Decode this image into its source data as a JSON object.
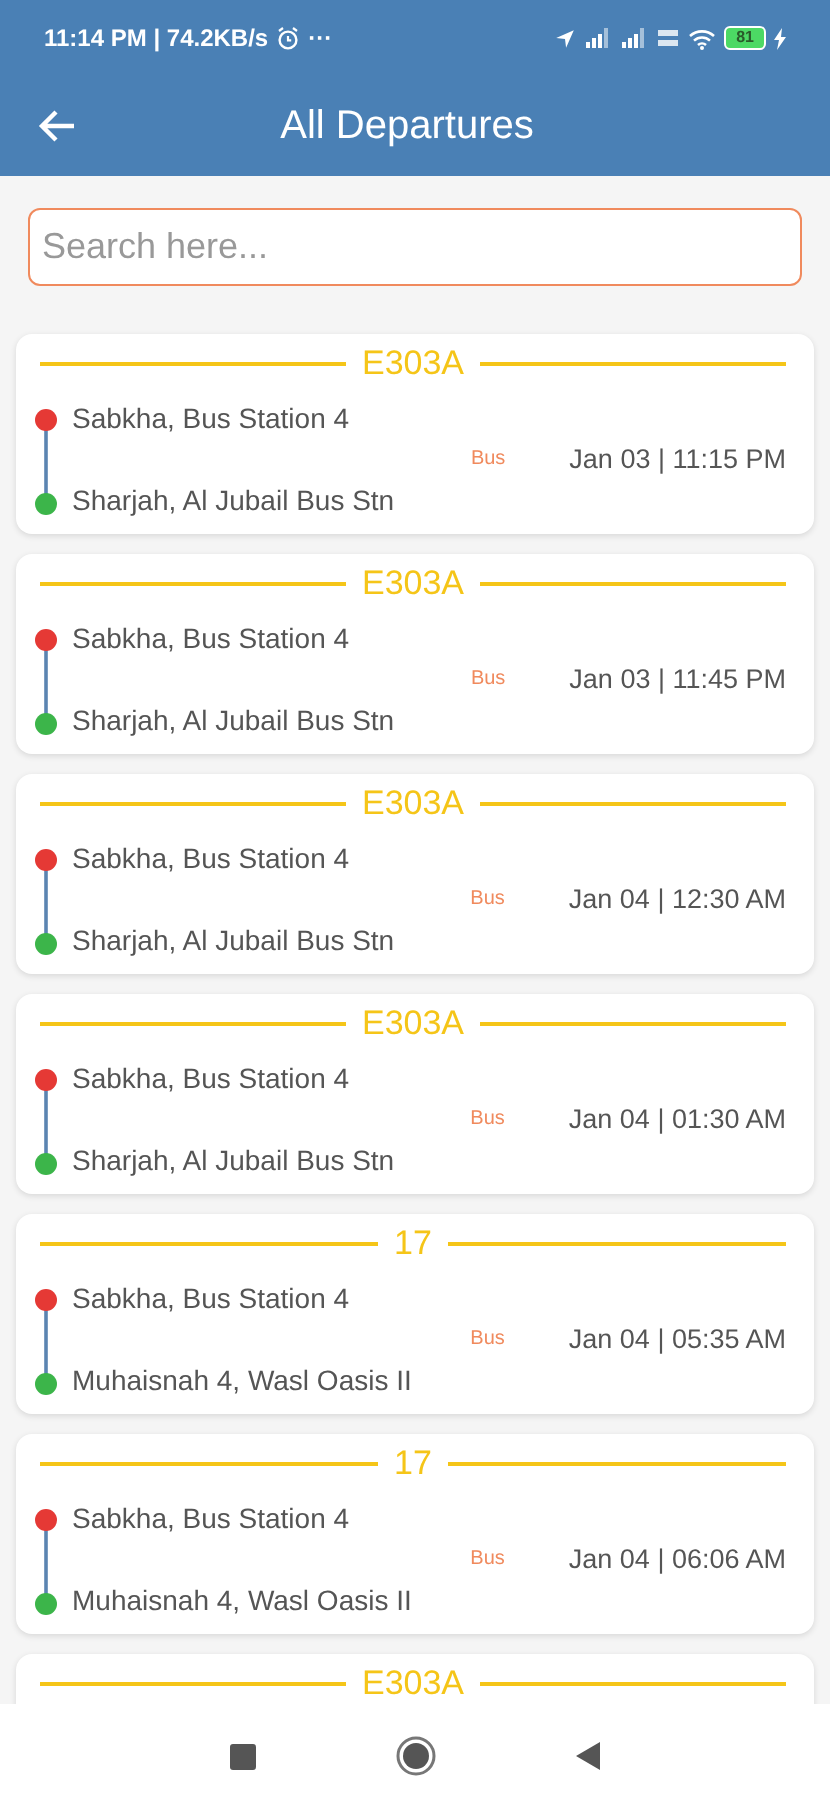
{
  "status_bar": {
    "time": "11:14 PM | 74.2KB/s",
    "more": "···",
    "battery": "81"
  },
  "app_bar": {
    "title": "All Departures"
  },
  "search": {
    "placeholder": "Search here..."
  },
  "departures": [
    {
      "route": "E303A",
      "from": "Sabkha, Bus Station 4",
      "to": "Sharjah, Al Jubail Bus Stn",
      "mode": "Bus",
      "time": "Jan 03 | 11:15 PM"
    },
    {
      "route": "E303A",
      "from": "Sabkha, Bus Station 4",
      "to": "Sharjah, Al Jubail Bus Stn",
      "mode": "Bus",
      "time": "Jan 03 | 11:45 PM"
    },
    {
      "route": "E303A",
      "from": "Sabkha, Bus Station 4",
      "to": "Sharjah, Al Jubail Bus Stn",
      "mode": "Bus",
      "time": "Jan 04 | 12:30 AM"
    },
    {
      "route": "E303A",
      "from": "Sabkha, Bus Station 4",
      "to": "Sharjah, Al Jubail Bus Stn",
      "mode": "Bus",
      "time": "Jan 04 | 01:30 AM"
    },
    {
      "route": "17",
      "from": "Sabkha, Bus Station 4",
      "to": "Muhaisnah 4, Wasl Oasis II",
      "mode": "Bus",
      "time": "Jan 04 | 05:35 AM"
    },
    {
      "route": "17",
      "from": "Sabkha, Bus Station 4",
      "to": "Muhaisnah 4, Wasl Oasis II",
      "mode": "Bus",
      "time": "Jan 04 | 06:06 AM"
    },
    {
      "route": "E303A"
    }
  ]
}
